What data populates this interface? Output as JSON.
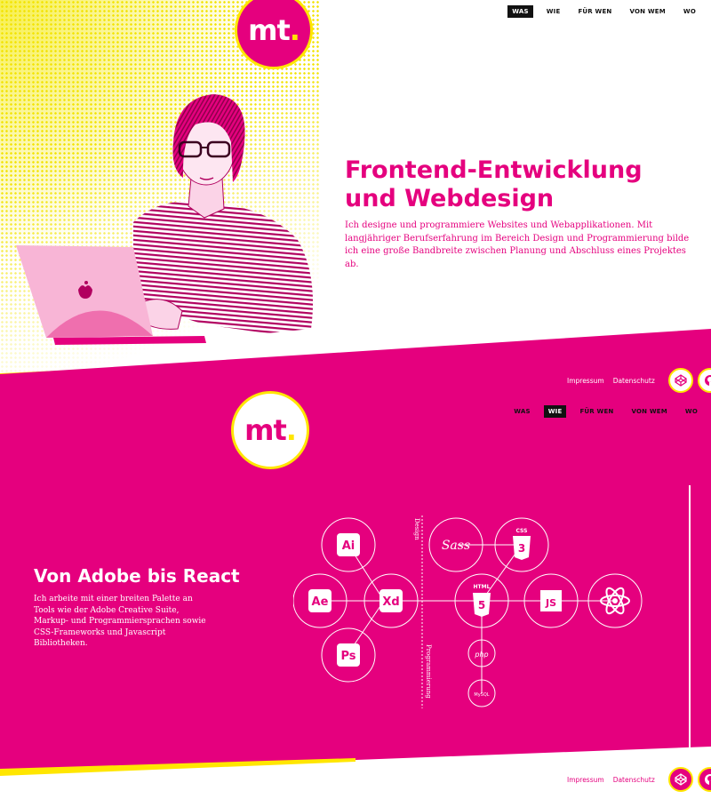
{
  "nav": {
    "items": [
      "WAS",
      "WIE",
      "FÜR WEN",
      "VON WEM",
      "WO"
    ]
  },
  "logo": {
    "text": "mt",
    "dot": "."
  },
  "hero": {
    "title_line1": "Frontend-Entwicklung",
    "title_line2": "und Webdesign",
    "text": "Ich designe und programmiere Websites und Webapplikationen. Mit langjähriger Berufserfahrung im Bereich Design und Programmierung bilde ich eine große Bandbreite zwischen Planung und Abschluss eines Projektes ab."
  },
  "footer": {
    "impressum": "Impressum",
    "datenschutz": "Datenschutz",
    "icons": [
      "codepen-icon",
      "github-icon"
    ]
  },
  "tools": {
    "title": "Von Adobe bis React",
    "text": "Ich arbeite mit einer breiten Palette an Tools wie der Adobe Creative Suite, Markup- und Programmiersprachen sowie CSS-Frameworks und Javascript Bibliotheken.",
    "label_design": "Design",
    "label_programming": "Programmierung",
    "nodes": {
      "ai": "Ai",
      "ae": "Ae",
      "xd": "Xd",
      "ps": "Ps",
      "sass": "Sass",
      "css": "CSS",
      "html": "HTML",
      "js": "JS",
      "php": "php",
      "mysql": "MySQL"
    }
  },
  "colors": {
    "pink": "#e5007e",
    "yellow": "#ffe600",
    "black": "#111111",
    "white": "#ffffff"
  }
}
